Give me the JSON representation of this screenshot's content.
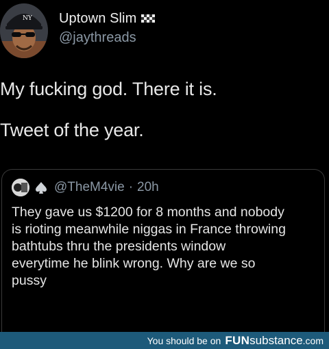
{
  "tweet": {
    "display_name": "Uptown Slim",
    "handle": "@jaythreads",
    "body_lines": [
      "My fucking god. There it is.",
      "Tweet of the year."
    ],
    "flag_icon": "checkered-flag-icon",
    "avatar_icon": "profile-photo"
  },
  "quoted_tweet": {
    "handle": "@TheM4vie",
    "separator": "·",
    "time": "20h",
    "spade_icon": "spade-icon",
    "text_lines": [
      "They gave us $1200 for 8 months and nobody",
      "is rioting meanwhile niggas in France throwing",
      "bathtubs thru the presidents window",
      "everytime he blink wrong. Why are we so",
      "pussy"
    ]
  },
  "footer": {
    "prefix": "You should be on",
    "brand_bold": "FUN",
    "brand_rest": "substance",
    "brand_domain": ".com",
    "background": "#1d5a7a"
  },
  "colors": {
    "background": "#000000",
    "secondary_text": "#8b98a5",
    "border": "#3a3a3a"
  }
}
